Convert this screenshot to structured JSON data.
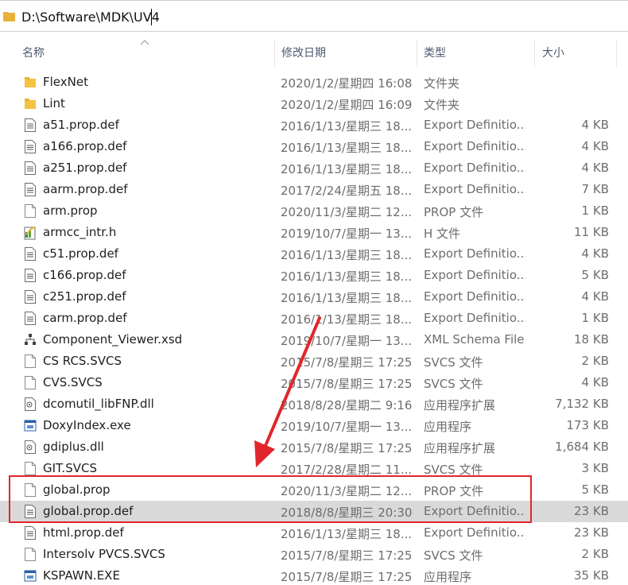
{
  "address_bar": {
    "path": "D:\\Software\\MDK\\UV4"
  },
  "columns": {
    "name": "名称",
    "modified": "修改日期",
    "type": "类型",
    "size": "大小"
  },
  "files": [
    {
      "name": "FlexNet",
      "date": "2020/1/2/星期四 16:08",
      "type": "文件夹",
      "size": "",
      "icon": "folder-icon"
    },
    {
      "name": "Lint",
      "date": "2020/1/2/星期四 16:09",
      "type": "文件夹",
      "size": "",
      "icon": "folder-icon"
    },
    {
      "name": "a51.prop.def",
      "date": "2016/1/13/星期三 18...",
      "type": "Export Definitio...",
      "size": "4 KB",
      "icon": "text-file-icon"
    },
    {
      "name": "a166.prop.def",
      "date": "2016/1/13/星期三 18...",
      "type": "Export Definitio...",
      "size": "4 KB",
      "icon": "text-file-icon"
    },
    {
      "name": "a251.prop.def",
      "date": "2016/1/13/星期三 18...",
      "type": "Export Definitio...",
      "size": "4 KB",
      "icon": "text-file-icon"
    },
    {
      "name": "aarm.prop.def",
      "date": "2017/2/24/星期五 18...",
      "type": "Export Definitio...",
      "size": "7 KB",
      "icon": "text-file-icon"
    },
    {
      "name": "arm.prop",
      "date": "2020/11/3/星期二 12...",
      "type": "PROP 文件",
      "size": "1 KB",
      "icon": "blank-file-icon"
    },
    {
      "name": "armcc_intr.h",
      "date": "2019/10/7/星期一 13...",
      "type": "H 文件",
      "size": "11 KB",
      "icon": "header-file-icon"
    },
    {
      "name": "c51.prop.def",
      "date": "2016/1/13/星期三 18...",
      "type": "Export Definitio...",
      "size": "4 KB",
      "icon": "text-file-icon"
    },
    {
      "name": "c166.prop.def",
      "date": "2016/1/13/星期三 18...",
      "type": "Export Definitio...",
      "size": "5 KB",
      "icon": "text-file-icon"
    },
    {
      "name": "c251.prop.def",
      "date": "2016/1/13/星期三 18...",
      "type": "Export Definitio...",
      "size": "4 KB",
      "icon": "text-file-icon"
    },
    {
      "name": "carm.prop.def",
      "date": "2016/1/13/星期三 18...",
      "type": "Export Definitio...",
      "size": "1 KB",
      "icon": "text-file-icon"
    },
    {
      "name": "Component_Viewer.xsd",
      "date": "2019/10/7/星期一 13...",
      "type": "XML Schema File",
      "size": "18 KB",
      "icon": "xml-schema-icon"
    },
    {
      "name": "CS RCS.SVCS",
      "date": "2015/7/8/星期三 17:25",
      "type": "SVCS 文件",
      "size": "2 KB",
      "icon": "blank-file-icon"
    },
    {
      "name": "CVS.SVCS",
      "date": "2015/7/8/星期三 17:25",
      "type": "SVCS 文件",
      "size": "4 KB",
      "icon": "blank-file-icon"
    },
    {
      "name": "dcomutil_libFNP.dll",
      "date": "2018/8/28/星期二 9:16",
      "type": "应用程序扩展",
      "size": "7,132 KB",
      "icon": "dll-file-icon"
    },
    {
      "name": "DoxyIndex.exe",
      "date": "2019/10/7/星期一 13...",
      "type": "应用程序",
      "size": "173 KB",
      "icon": "exe-file-icon"
    },
    {
      "name": "gdiplus.dll",
      "date": "2015/7/8/星期三 17:25",
      "type": "应用程序扩展",
      "size": "1,684 KB",
      "icon": "dll-file-icon"
    },
    {
      "name": "GIT.SVCS",
      "date": "2017/2/28/星期二 11...",
      "type": "SVCS 文件",
      "size": "3 KB",
      "icon": "blank-file-icon"
    },
    {
      "name": "global.prop",
      "date": "2020/11/3/星期二 12...",
      "type": "PROP 文件",
      "size": "5 KB",
      "icon": "blank-file-icon"
    },
    {
      "name": "global.prop.def",
      "date": "2018/8/8/星期三 20:30",
      "type": "Export Definitio...",
      "size": "23 KB",
      "icon": "text-file-icon",
      "selected": true
    },
    {
      "name": "html.prop.def",
      "date": "2016/1/13/星期三 18...",
      "type": "Export Definitio...",
      "size": "23 KB",
      "icon": "text-file-icon"
    },
    {
      "name": "Intersolv PVCS.SVCS",
      "date": "2015/7/8/星期三 17:25",
      "type": "SVCS 文件",
      "size": "2 KB",
      "icon": "blank-file-icon"
    },
    {
      "name": "KSPAWN.EXE",
      "date": "2015/7/8/星期三 17:25",
      "type": "应用程序",
      "size": "35 KB",
      "icon": "exe-file-icon"
    }
  ],
  "colors": {
    "highlight": "#e0262c",
    "selected_row": "#d9d9d9",
    "folder": "#f5c342"
  }
}
